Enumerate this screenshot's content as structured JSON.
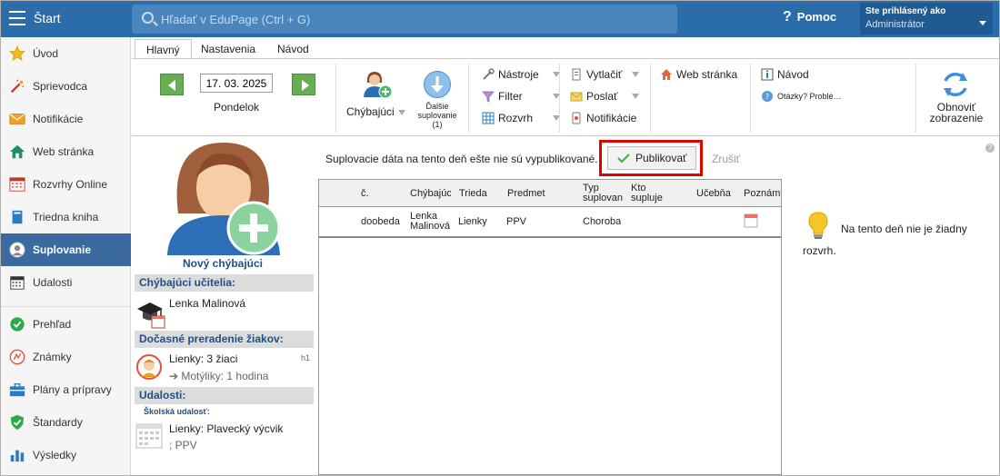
{
  "topbar": {
    "start_label": "Štart",
    "search_placeholder": "Hľadať v EduPage (Ctrl + G)",
    "help_label": "Pomoc",
    "user_line1": "Ste prihlásený ako",
    "user_line2": "Administrátor"
  },
  "sidebar": {
    "items": [
      {
        "label": "Úvod",
        "icon": "star-icon"
      },
      {
        "label": "Sprievodca",
        "icon": "magic-wand-icon"
      },
      {
        "label": "Notifikácie",
        "icon": "envelope-icon"
      },
      {
        "label": "Web stránka",
        "icon": "house-icon"
      },
      {
        "label": "Rozvrhy Online",
        "icon": "timetable-icon"
      },
      {
        "label": "Triedna kniha",
        "icon": "book-icon"
      },
      {
        "label": "Suplovanie",
        "icon": "person-icon"
      },
      {
        "label": "Udalosti",
        "icon": "calendar-icon"
      },
      {
        "label": "Prehľad",
        "icon": "check-circle-icon"
      },
      {
        "label": "Známky",
        "icon": "grades-icon"
      },
      {
        "label": "Plány a prípravy",
        "icon": "briefcase-icon"
      },
      {
        "label": "Štandardy",
        "icon": "shield-check-icon"
      },
      {
        "label": "Výsledky",
        "icon": "bar-chart-icon"
      }
    ]
  },
  "tabs": [
    "Hlavný",
    "Nastavenia",
    "Návod"
  ],
  "ribbon": {
    "date": "17. 03. 2025",
    "day": "Pondelok",
    "absent_label": "Chýbajúci",
    "next_sub_line1": "Ďalšie",
    "next_sub_line2": "suplovanie",
    "next_sub_line3": "(1)",
    "tools": "Nástroje",
    "filter": "Filter",
    "timetable": "Rozvrh",
    "print": "Vytlačiť",
    "send": "Poslať",
    "notifications": "Notifikácie",
    "website": "Web stránka",
    "manual": "Návod",
    "questions": "Otázky? Problé…",
    "refresh_line1": "Obnoviť",
    "refresh_line2": "zobrazenie"
  },
  "notice": "Suplovacie dáta na tento deň ešte nie sú vypublikované.",
  "publish_label": "Publikovať",
  "cancel_label": "Zrušiť",
  "grid": {
    "headers": {
      "c1": "č.",
      "c2": "Chýbajúci",
      "c3": "Trieda",
      "c4": "Predmet",
      "c5_l1": "Typ",
      "c5_l2": "suplovan",
      "c6_l1": "Kto",
      "c6_l2": "supluje",
      "c7": "Učebňa",
      "c8": "Poznám"
    },
    "rows": [
      {
        "c1": "doobeda",
        "c2_l1": "Lenka",
        "c2_l2": "Malinová",
        "c3": "Lienky",
        "c4": "PPV",
        "c5": "Choroba"
      }
    ]
  },
  "left": {
    "new_absent": "Nový chýbajúci",
    "sec_absent": "Chýbajúci učitelia:",
    "teacher": "Lenka Malinová",
    "sec_reassign": "Dočasné preradenie žiakov:",
    "reassign_line1": "Lienky: 3 žiaci",
    "reassign_line2": "➔ Motýliky: 1 hodina",
    "reassign_tag": "h1",
    "sec_events": "Udalosti:",
    "event_type": "Školská udalosť:",
    "event_line1": "Lienky: Plavecký výcvik",
    "event_line2": "; PPV"
  },
  "right": {
    "message": "Na tento deň nie je žiadny rozvrh."
  },
  "colors": {
    "topbar": "#2b6cab",
    "sidebar_active": "#3a6aa0",
    "section_text": "#1f4f86",
    "publish_highlight": "#e00000"
  }
}
